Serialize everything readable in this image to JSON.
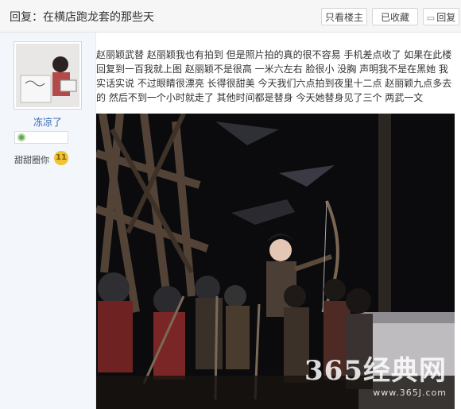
{
  "header": {
    "title": "回复：在横店跑龙套的那些天",
    "buttons": {
      "author_only": "只看楼主",
      "favorite": "已收藏",
      "reply": "回复"
    }
  },
  "user": {
    "name": "冻凉了",
    "honor_label": "甜甜圈你",
    "honor_level": "11"
  },
  "post": {
    "text": "赵丽颖武替 赵丽颖我也有拍到 但是照片拍的真的很不容易 手机差点收了 如果在此楼回复到一百我就上图 赵丽颖不是很高 一米六左右 脸很小 没胸 声明我不是在黑她 我实话实说 不过眼睛很漂亮 长得很甜美 今天我们六点拍到夜里十二点 赵丽颖九点多去的 然后不到一个小时就走了 其他时间都是替身 今天她替身见了三个 两武一文"
  },
  "photo": {
    "watermark_logo": "365经典网",
    "watermark_url": "www.365J.com"
  },
  "colors": {
    "username": "#2d64b3",
    "photo_bg": "#0b0b0d"
  }
}
